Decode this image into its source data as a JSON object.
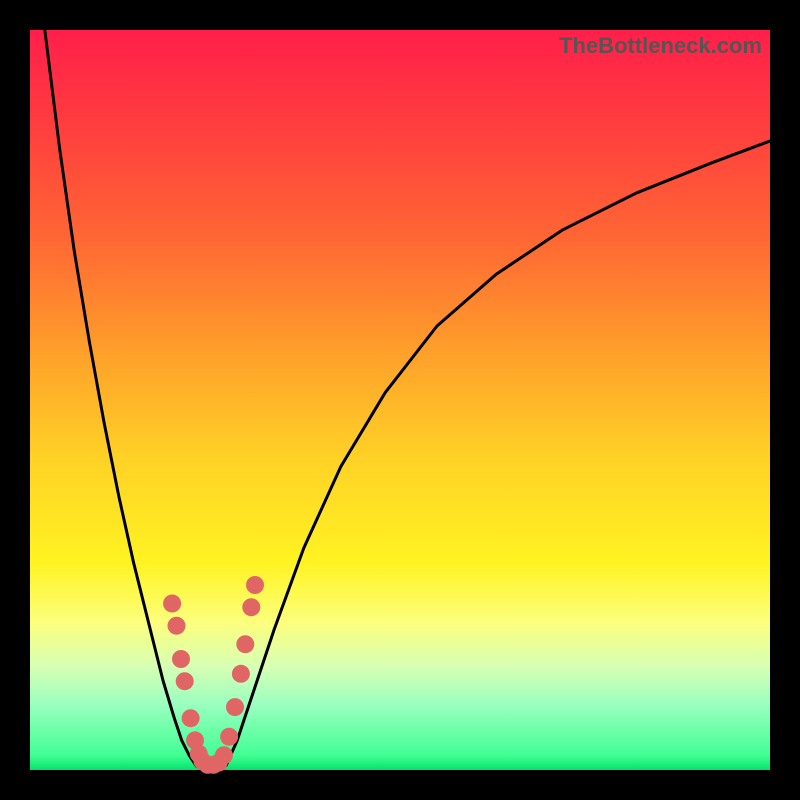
{
  "title": "TheBottleneck.com",
  "colors": {
    "frame": "#000000",
    "curve": "#000000",
    "markers": "#e06666",
    "gradient_top": "#ff1f4a",
    "gradient_bottom": "#04e36b"
  },
  "chart_data": {
    "type": "line",
    "title": "",
    "xlabel": "",
    "ylabel": "",
    "xlim": [
      0,
      100
    ],
    "ylim": [
      0,
      100
    ],
    "series": [
      {
        "name": "left-arm",
        "x": [
          2,
          4,
          6,
          8,
          10,
          12,
          14,
          16,
          18,
          19.5,
          20.5,
          21.5,
          22.5
        ],
        "y": [
          100,
          84,
          70,
          58,
          47,
          37,
          28,
          20,
          12,
          7,
          4,
          2,
          0.5
        ]
      },
      {
        "name": "basin",
        "x": [
          22.5,
          23.5,
          24.5,
          25.5,
          26.5
        ],
        "y": [
          0.5,
          0.2,
          0.2,
          0.3,
          0.6
        ]
      },
      {
        "name": "right-arm",
        "x": [
          26.5,
          28,
          30,
          33,
          37,
          42,
          48,
          55,
          63,
          72,
          82,
          92,
          100
        ],
        "y": [
          0.6,
          4,
          10,
          19,
          30,
          41,
          51,
          60,
          67,
          73,
          78,
          82,
          85
        ]
      }
    ],
    "markers": {
      "name": "highlight",
      "points": [
        {
          "x": 19.2,
          "y": 22.5
        },
        {
          "x": 19.8,
          "y": 19.5
        },
        {
          "x": 20.4,
          "y": 15.0
        },
        {
          "x": 20.9,
          "y": 12.0
        },
        {
          "x": 21.7,
          "y": 7.0
        },
        {
          "x": 22.3,
          "y": 4.0
        },
        {
          "x": 22.8,
          "y": 2.2
        },
        {
          "x": 23.3,
          "y": 1.2
        },
        {
          "x": 24.0,
          "y": 0.7
        },
        {
          "x": 24.8,
          "y": 0.7
        },
        {
          "x": 25.5,
          "y": 1.0
        },
        {
          "x": 26.2,
          "y": 2.0
        },
        {
          "x": 26.9,
          "y": 4.5
        },
        {
          "x": 27.7,
          "y": 8.5
        },
        {
          "x": 28.5,
          "y": 13.0
        },
        {
          "x": 29.1,
          "y": 17.0
        },
        {
          "x": 29.9,
          "y": 22.0
        },
        {
          "x": 30.4,
          "y": 25.0
        }
      ]
    }
  }
}
